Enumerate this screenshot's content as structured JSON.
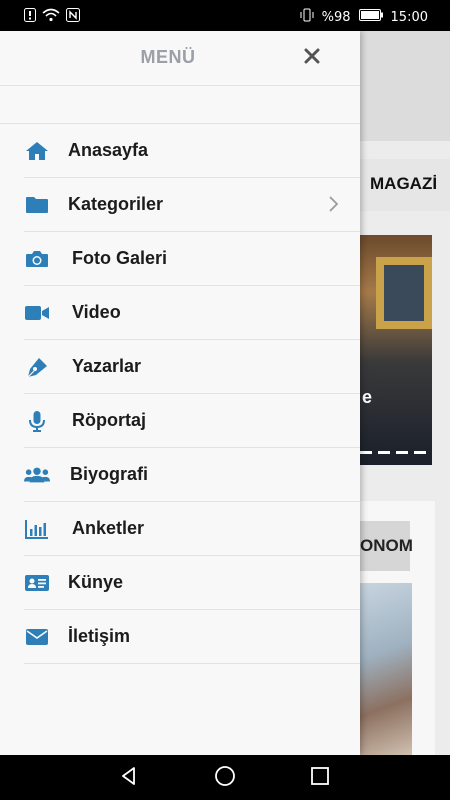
{
  "statusbar": {
    "battery_percent": "%98",
    "time": "15:00"
  },
  "drawer": {
    "title": "MENÜ",
    "items": [
      {
        "label": "Anasayfa",
        "icon": "home-icon"
      },
      {
        "label": "Kategoriler",
        "icon": "folder-icon",
        "has_submenu": true
      },
      {
        "label": "Foto Galeri",
        "icon": "camera-icon"
      },
      {
        "label": "Video",
        "icon": "video-camera-icon"
      },
      {
        "label": "Yazarlar",
        "icon": "pen-icon"
      },
      {
        "label": "Röportaj",
        "icon": "microphone-icon"
      },
      {
        "label": "Biyografi",
        "icon": "users-icon"
      },
      {
        "label": "Anketler",
        "icon": "bar-chart-icon"
      },
      {
        "label": "Künye",
        "icon": "id-card-icon"
      },
      {
        "label": "İletişim",
        "icon": "envelope-icon"
      }
    ]
  },
  "background": {
    "category_label": "MAGAZİ",
    "card2_label": "ONOM",
    "photo_caption_fragment": "e"
  },
  "colors": {
    "icon_blue": "#2e7fb8",
    "title_gray": "#9aa0a6",
    "label_dark": "#1c1c1c"
  }
}
